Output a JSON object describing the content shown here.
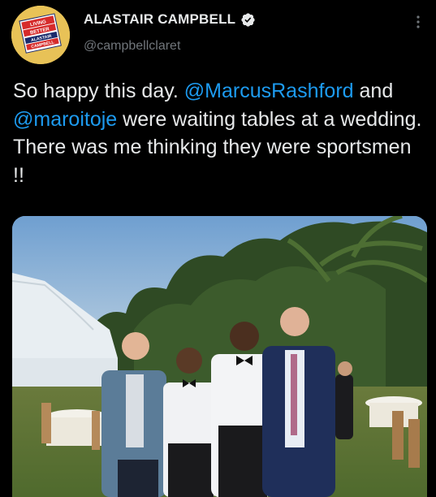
{
  "author": {
    "display_name": "ALASTAIR CAMPBELL",
    "handle": "@campbellclaret",
    "verified": true,
    "avatar_text": [
      "LIVING",
      "BETTER",
      "ALASTAIR",
      "CAMPBELL"
    ]
  },
  "tweet": {
    "text_intro": "So happy this day. ",
    "mention_1": "@MarcusRashford",
    "text_mid_1": " and ",
    "mention_2": "@maroitoje",
    "text_end": " were waiting tables at a wedding. There was me thinking they were sportsmen !!"
  },
  "icons": {
    "verified": "verified-badge-icon",
    "more": "more-options-icon"
  },
  "colors": {
    "background": "#000000",
    "text": "#e7e9ea",
    "secondary": "#71767b",
    "link": "#1d9bf0",
    "verified_badge": "#e7e9ea"
  }
}
